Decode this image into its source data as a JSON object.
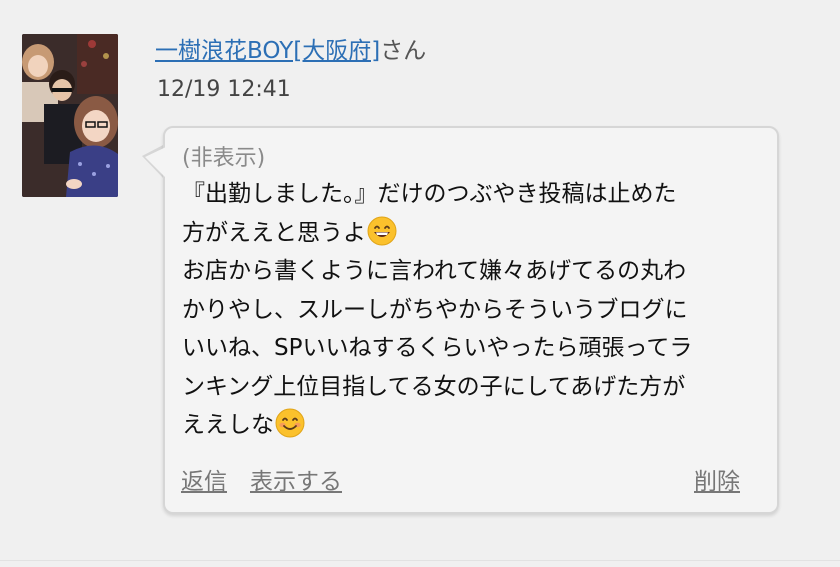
{
  "user": {
    "name": "一樹浪花BOY[大阪府]",
    "honorific": "さん"
  },
  "post": {
    "date": "12/19 12:41",
    "hidden_label": "(非表示)",
    "lines": [
      "『出勤しました。』だけのつぶやき投稿は止めた",
      "方がええと思うよ",
      "お店から書くように言われて嫌々あげてるの丸わ",
      "かりやし、スルーしがちやからそういうブログに",
      "いいね、SPいいねするくらいやったら頑張ってラ",
      "ンキング上位目指してる女の子にしてあげた方が",
      "ええしな"
    ],
    "emoji_1": "grinning-face-with-smiling-eyes",
    "emoji_2": "smiling-face-with-smiling-eyes"
  },
  "actions": {
    "reply": "返信",
    "show": "表示する",
    "delete": "削除"
  },
  "colors": {
    "link": "#2c6fb5",
    "bubble_bg": "#f4f4f4",
    "page_bg": "#f0f0f0",
    "emoji": "#fbc12c"
  }
}
